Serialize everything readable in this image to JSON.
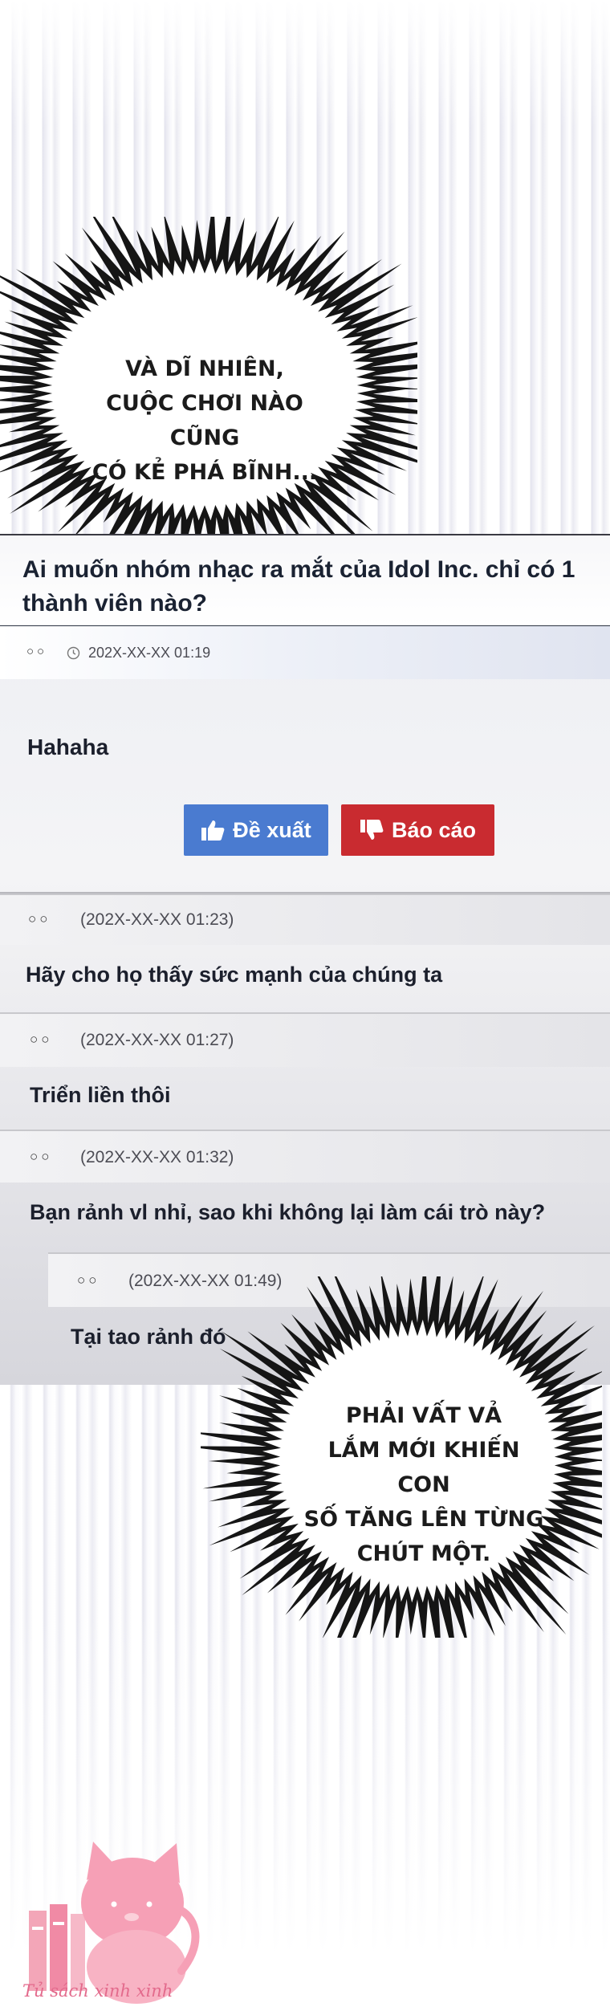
{
  "bubbles": {
    "top": {
      "lines": "VÀ DĨ NHIÊN,\nCUỘC CHƠI NÀO CŨNG\nCÓ KẺ PHÁ BĨNH..."
    },
    "bottom": {
      "lines": "PHẢI VẤT VẢ\nLẮM MỚI KHIẾN CON\nSỐ TĂNG LÊN TỪNG\nCHÚT MỘT."
    }
  },
  "post": {
    "title": "Ai muốn nhóm nhạc ra mắt của Idol Inc. chỉ có 1 thành viên nào?",
    "author_icon": "○○",
    "clock_icon": "clock-icon",
    "timestamp": "202X-XX-XX 01:19",
    "body": "Hahaha",
    "upvote_label": "Đề xuất",
    "report_label": "Báo cáo",
    "upvote_icon": "thumbs-up-icon",
    "report_icon": "thumbs-down-icon",
    "upvote_color": "#4a7bd0",
    "report_color": "#c92b30"
  },
  "comments": [
    {
      "author": "○○",
      "time": "(202X-XX-XX 01:23)",
      "text": "Hãy cho họ thấy sức mạnh của chúng ta"
    },
    {
      "author": "○○",
      "time": "(202X-XX-XX 01:27)",
      "text": "Triển liền thôi"
    },
    {
      "author": "○○",
      "time": "(202X-XX-XX 01:32)",
      "text": "Bạn rảnh vl nhỉ, sao khi không lại làm cái trò này?"
    }
  ],
  "reply": {
    "author": "○○",
    "time": "(202X-XX-XX 01:49)",
    "text": "Tại tao rảnh đó"
  },
  "watermark": {
    "text": "Tủ sách xinh xinh",
    "icon": "pink-cat-bookshelf-logo"
  }
}
